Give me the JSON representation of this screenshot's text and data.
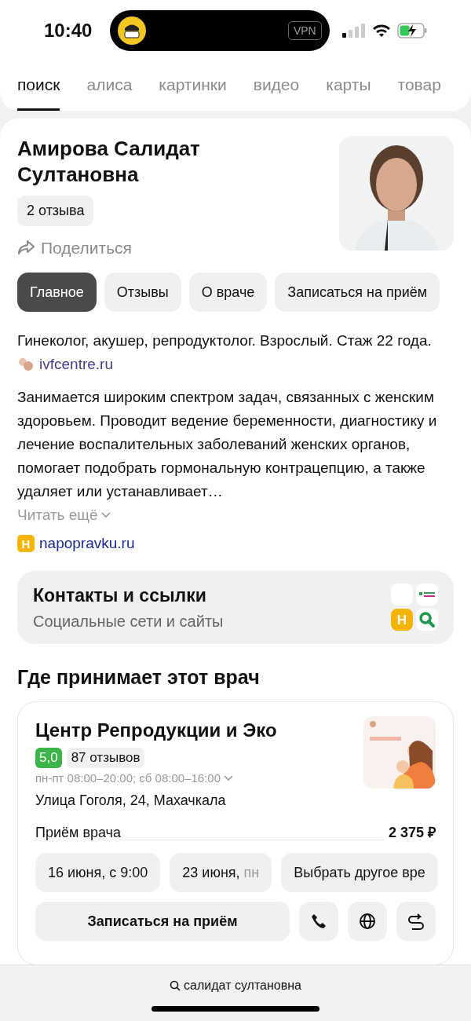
{
  "status_bar": {
    "time": "10:40",
    "vpn": "VPN"
  },
  "tabs": [
    {
      "label": "поиск",
      "selected": true
    },
    {
      "label": "алиса",
      "selected": false
    },
    {
      "label": "картинки",
      "selected": false
    },
    {
      "label": "видео",
      "selected": false
    },
    {
      "label": "карты",
      "selected": false
    },
    {
      "label": "товар",
      "selected": false
    }
  ],
  "doctor": {
    "name": "Амирова Салидат Султановна",
    "reviews": "2 отзыва",
    "share": "Поделиться",
    "sections": [
      {
        "label": "Главное",
        "selected": true
      },
      {
        "label": "Отзывы",
        "selected": false
      },
      {
        "label": "О враче",
        "selected": false
      },
      {
        "label": "Записаться на приём",
        "selected": false
      }
    ],
    "specialty": "Гинеколог, акушер, репродуктолог. Взрослый. Стаж 22 года.",
    "site": "ivfcentre.ru",
    "about": "Занимается широким спектром задач, связанных с женским здоровьем. Проводит ведение беременности, диагностику и лечение воспалительных заболеваний женских органов, помогает подобрать гормональную контрацепцию, а также удаляет или устанавливает…",
    "read_more": "Читать ещё",
    "source": "napopravku.ru",
    "source_badge": "Н"
  },
  "contacts": {
    "title": "Контакты и ссылки",
    "subtitle": "Социальные сети и сайты",
    "badge": "Н"
  },
  "clinics_heading": "Где принимает этот врач",
  "clinic": {
    "name": "Центр Репродукции и Эко",
    "rating": "5,0",
    "reviews": "87 отзывов",
    "hours": "пн-пт 08:00–20:00; сб 08:00–16:00",
    "address": "Улица Гоголя, 24, Махачкала",
    "service": "Приём врача",
    "price": "2 375 ₽",
    "slots": [
      {
        "text": "16 июня, с 9:00"
      },
      {
        "text": "23 июня,",
        "weekday": "пн"
      },
      {
        "text": "Выбрать другое вре"
      }
    ],
    "book": "Записаться на приём"
  },
  "search_bar": {
    "query": "салидат султановна"
  }
}
